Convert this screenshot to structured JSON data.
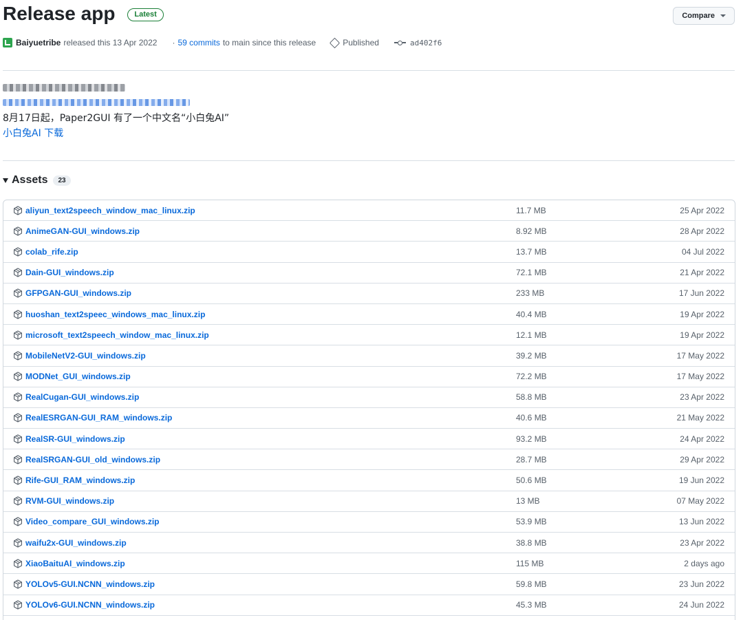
{
  "release": {
    "title": "Release app",
    "latest_badge": "Latest",
    "compare_label": "Compare"
  },
  "meta": {
    "author": "Baiyuetribe",
    "released_text": "released this 13 Apr 2022",
    "commits_prefix": "·",
    "commits_link": "59 commits",
    "commits_suffix": "to main since this release",
    "tag_label": "Published",
    "commit_hash": "ad402f6"
  },
  "notes": {
    "line1": "8月17日起，Paper2GUI 有了一个中文名“小白兔AI”",
    "link": "小白兔AI 下载"
  },
  "assets": {
    "label": "Assets",
    "count": "23",
    "items": [
      {
        "name": "aliyun_text2speech_window_mac_linux.zip",
        "size": "11.7 MB",
        "date": "25 Apr 2022"
      },
      {
        "name": "AnimeGAN-GUI_windows.zip",
        "size": "8.92 MB",
        "date": "28 Apr 2022"
      },
      {
        "name": "colab_rife.zip",
        "size": "13.7 MB",
        "date": "04 Jul 2022"
      },
      {
        "name": "Dain-GUI_windows.zip",
        "size": "72.1 MB",
        "date": "21 Apr 2022"
      },
      {
        "name": "GFPGAN-GUI_windows.zip",
        "size": "233 MB",
        "date": "17 Jun 2022"
      },
      {
        "name": "huoshan_text2speec_windows_mac_linux.zip",
        "size": "40.4 MB",
        "date": "19 Apr 2022"
      },
      {
        "name": "microsoft_text2speech_window_mac_linux.zip",
        "size": "12.1 MB",
        "date": "19 Apr 2022"
      },
      {
        "name": "MobileNetV2-GUI_windows.zip",
        "size": "39.2 MB",
        "date": "17 May 2022"
      },
      {
        "name": "MODNet_GUI_windows.zip",
        "size": "72.2 MB",
        "date": "17 May 2022"
      },
      {
        "name": "RealCugan-GUI_windows.zip",
        "size": "58.8 MB",
        "date": "23 Apr 2022"
      },
      {
        "name": "RealESRGAN-GUI_RAM_windows.zip",
        "size": "40.6 MB",
        "date": "21 May 2022"
      },
      {
        "name": "RealSR-GUI_windows.zip",
        "size": "93.2 MB",
        "date": "24 Apr 2022"
      },
      {
        "name": "RealSRGAN-GUI_old_windows.zip",
        "size": "28.7 MB",
        "date": "29 Apr 2022"
      },
      {
        "name": "Rife-GUI_RAM_windows.zip",
        "size": "50.6 MB",
        "date": "19 Jun 2022"
      },
      {
        "name": "RVM-GUI_windows.zip",
        "size": "13 MB",
        "date": "07 May 2022"
      },
      {
        "name": "Video_compare_GUI_windows.zip",
        "size": "53.9 MB",
        "date": "13 Jun 2022"
      },
      {
        "name": "waifu2x-GUI_windows.zip",
        "size": "38.8 MB",
        "date": "23 Apr 2022"
      },
      {
        "name": "XiaoBaituAI_windows.zip",
        "size": "115 MB",
        "date": "2 days ago"
      },
      {
        "name": "YOLOv5-GUI.NCNN_windows.zip",
        "size": "59.8 MB",
        "date": "23 Jun 2022"
      },
      {
        "name": "YOLOv6-GUI.NCNN_windows.zip",
        "size": "45.3 MB",
        "date": "24 Jun 2022"
      }
    ]
  },
  "colors": {
    "link": "#0969da",
    "latest": "#1a7f37",
    "muted": "#57606a"
  }
}
